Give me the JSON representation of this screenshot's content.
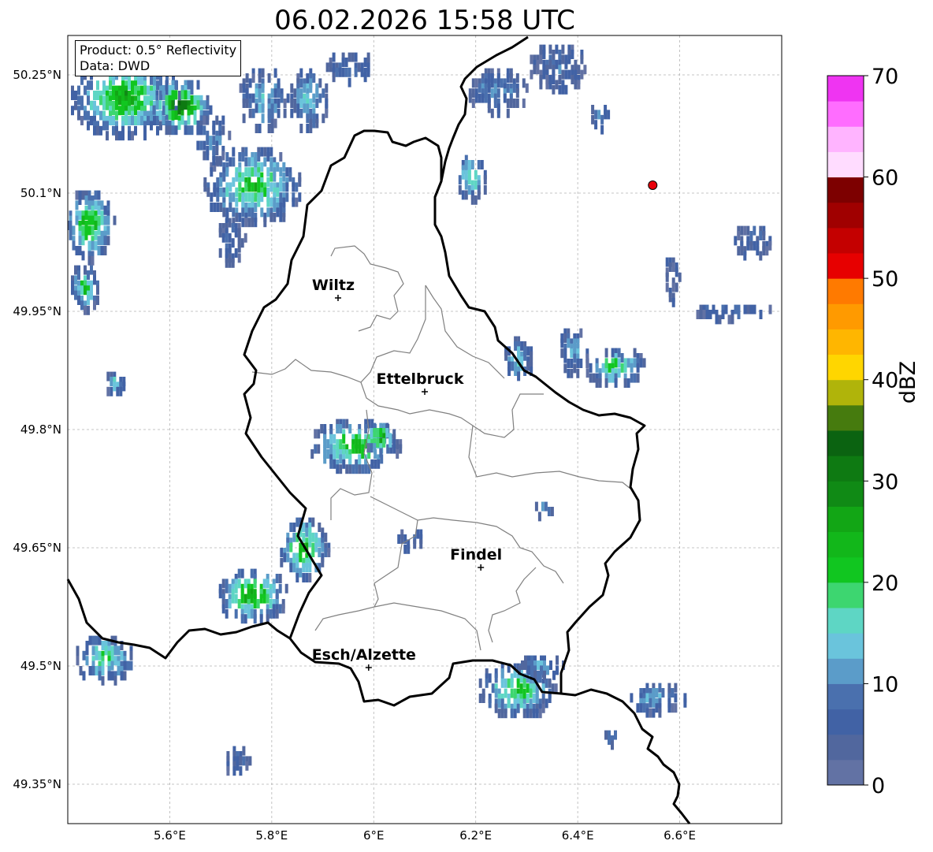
{
  "title": "06.02.2026 15:58 UTC",
  "info": {
    "product": "Product: 0.5° Reflectivity",
    "source": "Data: DWD"
  },
  "map_extent": {
    "lon": [
      5.4,
      6.8
    ],
    "lat": [
      49.3,
      50.3
    ]
  },
  "lon_ticks": [
    {
      "value": 5.6,
      "label": "5.6°E"
    },
    {
      "value": 5.8,
      "label": "5.8°E"
    },
    {
      "value": 6.0,
      "label": "6°E"
    },
    {
      "value": 6.2,
      "label": "6.2°E"
    },
    {
      "value": 6.4,
      "label": "6.4°E"
    },
    {
      "value": 6.6,
      "label": "6.6°E"
    }
  ],
  "lat_ticks": [
    {
      "value": 50.25,
      "label": "50.25°N"
    },
    {
      "value": 50.1,
      "label": "50.1°N"
    },
    {
      "value": 49.95,
      "label": "49.95°N"
    },
    {
      "value": 49.8,
      "label": "49.8°N"
    },
    {
      "value": 49.65,
      "label": "49.65°N"
    },
    {
      "value": 49.5,
      "label": "49.5°N"
    },
    {
      "value": 49.35,
      "label": "49.35°N"
    }
  ],
  "cities": [
    {
      "name": "Wiltz",
      "lon": 5.93,
      "lat": 49.967
    },
    {
      "name": "Ettelbruck",
      "lon": 6.1,
      "lat": 49.848
    },
    {
      "name": "Findel",
      "lon": 6.21,
      "lat": 49.625
    },
    {
      "name": "Esch/Alzette",
      "lon": 5.99,
      "lat": 49.498
    }
  ],
  "radar_site": {
    "lon": 6.547,
    "lat": 50.11,
    "color": "#e8000b"
  },
  "colorbar": {
    "label": "dBZ",
    "min": 0,
    "max": 70,
    "step": 2.5,
    "tick_values": [
      0,
      10,
      20,
      30,
      40,
      50,
      60,
      70
    ],
    "tick_labels": [
      "0",
      "10",
      "20",
      "30",
      "40",
      "50",
      "60",
      "70"
    ],
    "colors": [
      "#6272a4",
      "#51679e",
      "#4162a5",
      "#4a70ae",
      "#5b9cc9",
      "#6ac4dc",
      "#5ed6c4",
      "#3dd670",
      "#11c620",
      "#12b71a",
      "#12a615",
      "#108a15",
      "#0e7a12",
      "#0b6311",
      "#467b0e",
      "#b0b40a",
      "#ffd600",
      "#ffb600",
      "#ff9a00",
      "#ff7a00",
      "#e70000",
      "#c40000",
      "#a00000",
      "#7d0000",
      "#ffdcff",
      "#ffb4ff",
      "#ff6dff",
      "#ef34f2"
    ]
  },
  "echo_cells": [
    {
      "lon": 5.51,
      "lat": 50.22,
      "rlon": 0.11,
      "rlat": 0.05,
      "dbz": 28
    },
    {
      "lon": 5.62,
      "lat": 50.21,
      "rlon": 0.06,
      "rlat": 0.035,
      "dbz": 35
    },
    {
      "lon": 5.44,
      "lat": 50.06,
      "rlon": 0.05,
      "rlat": 0.045,
      "dbz": 27
    },
    {
      "lon": 5.43,
      "lat": 49.98,
      "rlon": 0.03,
      "rlat": 0.03,
      "dbz": 22
    },
    {
      "lon": 5.76,
      "lat": 50.11,
      "rlon": 0.1,
      "rlat": 0.05,
      "dbz": 24
    },
    {
      "lon": 5.72,
      "lat": 50.04,
      "rlon": 0.03,
      "rlat": 0.03,
      "dbz": 8
    },
    {
      "lon": 5.78,
      "lat": 50.22,
      "rlon": 0.05,
      "rlat": 0.04,
      "dbz": 14
    },
    {
      "lon": 5.68,
      "lat": 50.17,
      "rlon": 0.04,
      "rlat": 0.03,
      "dbz": 12
    },
    {
      "lon": 5.87,
      "lat": 50.22,
      "rlon": 0.04,
      "rlat": 0.04,
      "dbz": 16
    },
    {
      "lon": 5.95,
      "lat": 50.26,
      "rlon": 0.05,
      "rlat": 0.02,
      "dbz": 9
    },
    {
      "lon": 6.24,
      "lat": 50.23,
      "rlon": 0.06,
      "rlat": 0.03,
      "dbz": 12
    },
    {
      "lon": 6.36,
      "lat": 50.26,
      "rlon": 0.06,
      "rlat": 0.03,
      "dbz": 8
    },
    {
      "lon": 6.19,
      "lat": 50.12,
      "rlon": 0.03,
      "rlat": 0.03,
      "dbz": 22
    },
    {
      "lon": 6.44,
      "lat": 50.2,
      "rlon": 0.02,
      "rlat": 0.02,
      "dbz": 9
    },
    {
      "lon": 6.74,
      "lat": 50.04,
      "rlon": 0.04,
      "rlat": 0.02,
      "dbz": 8
    },
    {
      "lon": 6.58,
      "lat": 49.99,
      "rlon": 0.02,
      "rlat": 0.03,
      "dbz": 6
    },
    {
      "lon": 6.7,
      "lat": 49.95,
      "rlon": 0.08,
      "rlat": 0.01,
      "dbz": 10
    },
    {
      "lon": 6.47,
      "lat": 49.88,
      "rlon": 0.06,
      "rlat": 0.025,
      "dbz": 23
    },
    {
      "lon": 6.39,
      "lat": 49.9,
      "rlon": 0.03,
      "rlat": 0.03,
      "dbz": 14
    },
    {
      "lon": 6.28,
      "lat": 49.89,
      "rlon": 0.03,
      "rlat": 0.03,
      "dbz": 16
    },
    {
      "lon": 5.96,
      "lat": 49.78,
      "rlon": 0.09,
      "rlat": 0.035,
      "dbz": 26
    },
    {
      "lon": 6.01,
      "lat": 49.79,
      "rlon": 0.03,
      "rlat": 0.02,
      "dbz": 32
    },
    {
      "lon": 5.86,
      "lat": 49.65,
      "rlon": 0.05,
      "rlat": 0.04,
      "dbz": 28
    },
    {
      "lon": 5.76,
      "lat": 49.59,
      "rlon": 0.07,
      "rlat": 0.035,
      "dbz": 29
    },
    {
      "lon": 5.47,
      "lat": 49.51,
      "rlon": 0.06,
      "rlat": 0.03,
      "dbz": 22
    },
    {
      "lon": 6.28,
      "lat": 49.47,
      "rlon": 0.08,
      "rlat": 0.035,
      "dbz": 24
    },
    {
      "lon": 6.32,
      "lat": 49.5,
      "rlon": 0.05,
      "rlat": 0.015,
      "dbz": 13
    },
    {
      "lon": 6.55,
      "lat": 49.46,
      "rlon": 0.06,
      "rlat": 0.02,
      "dbz": 14
    },
    {
      "lon": 6.07,
      "lat": 49.66,
      "rlon": 0.03,
      "rlat": 0.015,
      "dbz": 8
    },
    {
      "lon": 5.73,
      "lat": 49.38,
      "rlon": 0.025,
      "rlat": 0.02,
      "dbz": 9
    },
    {
      "lon": 5.49,
      "lat": 49.86,
      "rlon": 0.02,
      "rlat": 0.015,
      "dbz": 16
    },
    {
      "lon": 6.33,
      "lat": 49.7,
      "rlon": 0.02,
      "rlat": 0.01,
      "dbz": 12
    },
    {
      "lon": 6.46,
      "lat": 49.41,
      "rlon": 0.02,
      "rlat": 0.01,
      "dbz": 9
    }
  ]
}
